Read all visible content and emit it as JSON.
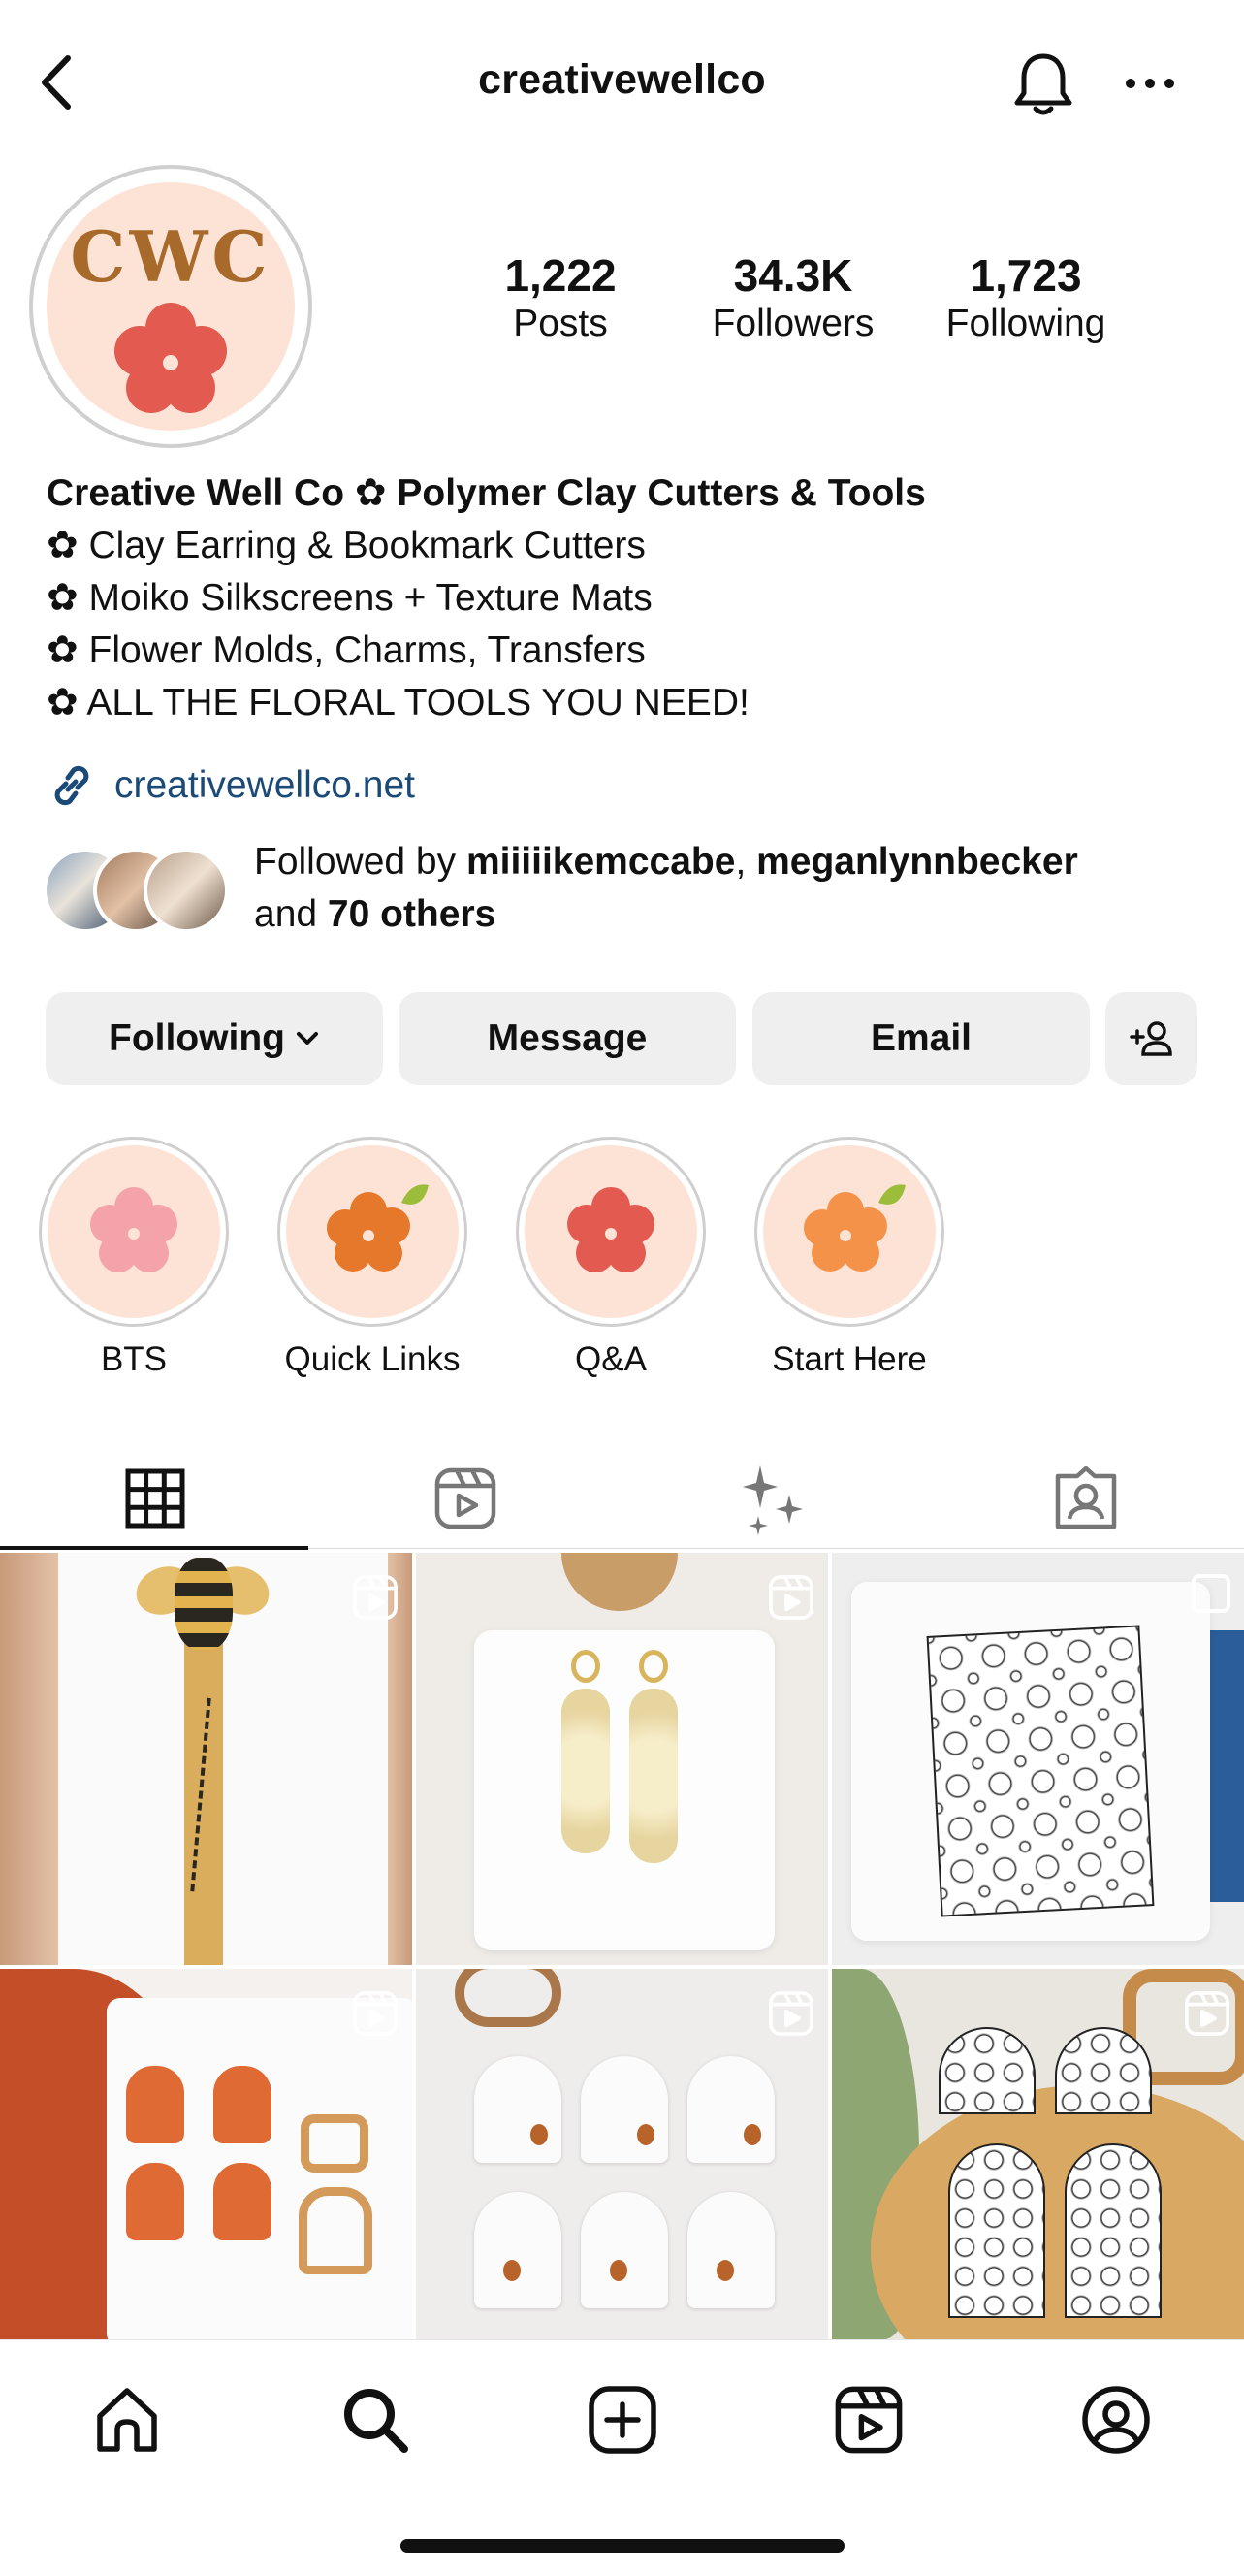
{
  "header": {
    "username": "creativewellco",
    "back_icon": "chevron-left-icon",
    "bell_icon": "bell-icon",
    "more_icon": "more-horizontal-icon"
  },
  "profile_pic": {
    "text": "CWC"
  },
  "stats": {
    "posts_value": "1,222",
    "posts_label": "Posts",
    "followers_value": "34.3K",
    "followers_label": "Followers",
    "following_value": "1,723",
    "following_label": "Following"
  },
  "bio": {
    "name": "Creative Well Co ✿ Polymer Clay Cutters & Tools",
    "lines": [
      "✿ Clay Earring & Bookmark Cutters",
      "✿ Moiko Silkscreens + Texture Mats",
      "✿ Flower Molds, Charms, Transfers",
      "✿ ALL THE FLORAL TOOLS YOU NEED!"
    ],
    "link": "creativewellco.net"
  },
  "followed_by": {
    "prefix": "Followed by ",
    "user1": "miiiiikemccabe",
    "sep": ", ",
    "user2": "meganlynnbecker",
    "and": "and ",
    "others": "70 others"
  },
  "actions": {
    "following": "Following",
    "message": "Message",
    "email": "Email"
  },
  "highlights": [
    {
      "label": "BTS",
      "color": "#f5a3ab"
    },
    {
      "label": "Quick Links",
      "color": "#e5782a"
    },
    {
      "label": "Q&A",
      "color": "#e25a50"
    },
    {
      "label": "Start Here",
      "color": "#f4924a"
    }
  ],
  "tabs": [
    "grid-icon",
    "reels-icon",
    "sparkles-icon",
    "tagged-icon"
  ],
  "colors": {
    "link": "#1c4a78",
    "accent_brown": "#a86a2a",
    "flower_red": "#e25a50",
    "pic_bg": "#fde3d6"
  }
}
